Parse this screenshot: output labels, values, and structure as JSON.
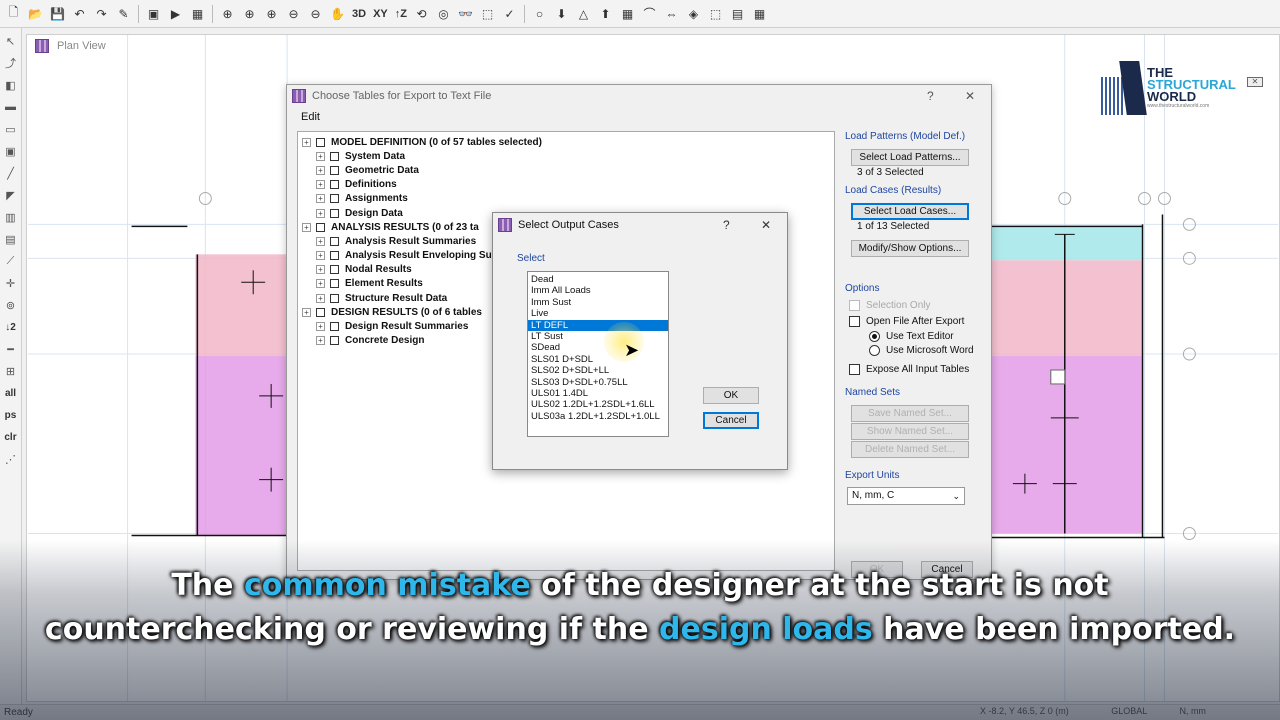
{
  "plan_window": {
    "title": "Plan View"
  },
  "toolbar": {
    "labels": [
      "3D",
      "XY",
      "Z"
    ]
  },
  "left_toolbar": {
    "labels": [
      "2",
      "all",
      "ps",
      "clr"
    ]
  },
  "logo": {
    "line1": "THE",
    "line2": "STRUCTURAL",
    "line3": "WORLD",
    "url": "www.thestructuralworld.com"
  },
  "export_dialog": {
    "title": "Choose Tables for Export to Text File",
    "help": "?",
    "close": "✕",
    "menu": "Edit",
    "tree": [
      {
        "label": "MODEL DEFINITION  (0 of 57 tables selected)",
        "level": 0
      },
      {
        "label": "System Data",
        "level": 1
      },
      {
        "label": "Geometric Data",
        "level": 1
      },
      {
        "label": "Definitions",
        "level": 1
      },
      {
        "label": "Assignments",
        "level": 1
      },
      {
        "label": "Design Data",
        "level": 1
      },
      {
        "label": "ANALYSIS RESULTS  (0 of 23 ta",
        "level": 0
      },
      {
        "label": "Analysis Result Summaries",
        "level": 1
      },
      {
        "label": "Analysis Result Enveloping Su",
        "level": 1
      },
      {
        "label": "Nodal Results",
        "level": 1
      },
      {
        "label": "Element Results",
        "level": 1
      },
      {
        "label": "Structure Result Data",
        "level": 1
      },
      {
        "label": "DESIGN RESULTS  (0 of 6 tables",
        "level": 0
      },
      {
        "label": "Design Result Summaries",
        "level": 1
      },
      {
        "label": "Concrete Design",
        "level": 1
      }
    ],
    "load_patterns_label": "Load Patterns (Model Def.)",
    "select_load_patterns": "Select Load Patterns...",
    "load_patterns_count": "3 of 3 Selected",
    "load_cases_label": "Load Cases (Results)",
    "select_load_cases": "Select Load Cases...",
    "load_cases_count": "1 of 13 Selected",
    "modify_show": "Modify/Show Options...",
    "options_label": "Options",
    "selection_only": "Selection Only",
    "open_file_after_export": "Open File After Export",
    "use_text_editor": "Use Text Editor",
    "use_microsoft_word": "Use Microsoft Word",
    "expose_all": "Expose All Input Tables",
    "named_sets_label": "Named Sets",
    "save_named_set": "Save Named Set...",
    "show_named_set": "Show Named Set...",
    "delete_named_set": "Delete Named Set...",
    "export_units_label": "Export Units",
    "export_units_value": "N, mm, C",
    "ok": "OK",
    "cancel": "Cancel"
  },
  "output_cases_dialog": {
    "title": "Select Output Cases",
    "help": "?",
    "close": "✕",
    "group_label": "Select",
    "cases": [
      "Dead",
      "Imm All Loads",
      "Imm Sust",
      "Live",
      "LT DEFL",
      "LT Sust",
      "SDead",
      "SLS01 D+SDL",
      "SLS02 D+SDL+LL",
      "SLS03 D+SDL+0.75LL",
      "ULS01 1.4DL",
      "ULS02 1.2DL+1.2SDL+1.6LL",
      "ULS03a 1.2DL+1.2SDL+1.0LL"
    ],
    "selected_case": "LT DEFL",
    "ok": "OK",
    "cancel": "Cancel"
  },
  "status": {
    "text": "Ready",
    "coords": "X -8.2, Y 46.5, Z 0 (m)",
    "units": "GLOBAL",
    "unit_select": "N, mm"
  },
  "subtitle": {
    "line1_a": "The ",
    "line1_hl": "common mistake",
    "line1_b": " of the designer at the start is not",
    "line2_a": "counterchecking or reviewing if the ",
    "line2_hl": "design loads",
    "line2_b": " have been imported."
  },
  "colors": {
    "accent": "#0078d7",
    "highlight": "#2fb6ea",
    "slab_pink": "#f2b6c8",
    "slab_violet": "#e39be6",
    "slab_cyan": "#a8e8ea"
  }
}
